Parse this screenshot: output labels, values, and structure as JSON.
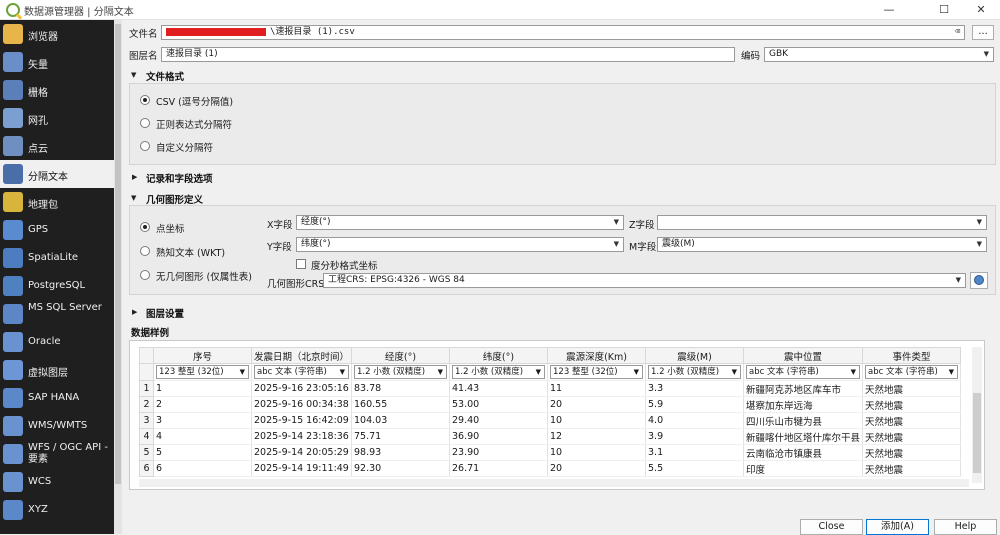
{
  "window": {
    "title": "数据源管理器 | 分隔文本",
    "minimize": "—",
    "maximize": "☐",
    "close": "✕"
  },
  "sidebar": {
    "items": [
      {
        "label": "浏览器",
        "icon": "folder-icon",
        "color": "#e8b54a"
      },
      {
        "label": "矢量",
        "icon": "vector-layer-icon",
        "color": "#6a8fc8"
      },
      {
        "label": "栅格",
        "icon": "raster-layer-icon",
        "color": "#5b7fb8"
      },
      {
        "label": "网孔",
        "icon": "mesh-layer-icon",
        "color": "#7a9fd0"
      },
      {
        "label": "点云",
        "icon": "point-cloud-icon",
        "color": "#6f8fc0"
      },
      {
        "label": "分隔文本",
        "icon": "delimited-text-icon",
        "color": "#4a6fa8"
      },
      {
        "label": "地理包",
        "icon": "geopackage-icon",
        "color": "#d8b43c"
      },
      {
        "label": "GPS",
        "icon": "gps-icon",
        "color": "#5a8ad0"
      },
      {
        "label": "SpatiaLite",
        "icon": "spatialite-icon",
        "color": "#4e7cc0"
      },
      {
        "label": "PostgreSQL",
        "icon": "postgresql-elephant-icon",
        "color": "#4f80c0"
      },
      {
        "label": "MS SQL Server",
        "icon": "mssql-icon",
        "color": "#5c86c6"
      },
      {
        "label": "Oracle",
        "icon": "oracle-database-icon",
        "color": "#6a92d0"
      },
      {
        "label": "虚拟图层",
        "icon": "virtual-layer-icon",
        "color": "#6d96d6"
      },
      {
        "label": "SAP HANA",
        "icon": "sap-hana-icon",
        "color": "#5b88c8"
      },
      {
        "label": "WMS/WMTS",
        "icon": "wms-globe-icon",
        "color": "#6a92cf"
      },
      {
        "label": "WFS / OGC API - 要素",
        "icon": "wfs-globe-icon",
        "color": "#6a92cf"
      },
      {
        "label": "WCS",
        "icon": "wcs-globe-icon",
        "color": "#6a92cf"
      },
      {
        "label": "XYZ",
        "icon": "xyz-tiles-icon",
        "color": "#5b88c8"
      }
    ]
  },
  "file": {
    "label": "文件名",
    "value": "\\速报目录 (1).csv",
    "browse": "…"
  },
  "layer": {
    "label": "图层名",
    "value": "速报目录 (1)",
    "encoding_label": "编码",
    "encoding_value": "GBK"
  },
  "file_format": {
    "title": "文件格式",
    "options": [
      "CSV (逗号分隔值)",
      "正则表达式分隔符",
      "自定义分隔符"
    ],
    "selected": 0
  },
  "records": {
    "title": "记录和字段选项"
  },
  "geometry": {
    "title": "几何图形定义",
    "options": [
      "点坐标",
      "熟知文本 (WKT)",
      "无几何图形 (仅属性表)"
    ],
    "x_label": "X字段",
    "x_value": "经度(°)",
    "y_label": "Y字段",
    "y_value": "纬度(°)",
    "z_label": "Z字段",
    "z_value": "",
    "m_label": "M字段",
    "m_value": "震级(M)",
    "dms_label": "度分秒格式坐标",
    "crs_label": "几何图形CRS",
    "crs_value": "工程CRS: EPSG:4326 - WGS 84"
  },
  "layer_settings": {
    "title": "图层设置"
  },
  "sample": {
    "title": "数据样例",
    "columns": [
      "序号",
      "发震日期（北京时间）",
      "经度(°)",
      "纬度(°)",
      "震源深度(Km)",
      "震级(M)",
      "震中位置",
      "事件类型"
    ],
    "types": [
      "123 整型 (32位)",
      "abc 文本 (字符串)",
      "1.2 小数 (双精度)",
      "1.2 小数 (双精度)",
      "123 整型 (32位)",
      "1.2 小数 (双精度)",
      "abc 文本 (字符串)",
      "abc 文本 (字符串)"
    ],
    "rows": [
      [
        "1",
        "2025-9-16 23:05:16",
        "83.78",
        "41.43",
        "11",
        "3.3",
        "新疆阿克苏地区库车市",
        "天然地震"
      ],
      [
        "2",
        "2025-9-16 00:34:38",
        "160.55",
        "53.00",
        "20",
        "5.9",
        "堪察加东岸远海",
        "天然地震"
      ],
      [
        "3",
        "2025-9-15 16:42:09",
        "104.03",
        "29.40",
        "10",
        "4.0",
        "四川乐山市犍为县",
        "天然地震"
      ],
      [
        "4",
        "2025-9-14 23:18:36",
        "75.71",
        "36.90",
        "12",
        "3.9",
        "新疆喀什地区塔什库尔干县",
        "天然地震"
      ],
      [
        "5",
        "2025-9-14 20:05:29",
        "98.93",
        "23.90",
        "10",
        "3.1",
        "云南临沧市镇康县",
        "天然地震"
      ],
      [
        "6",
        "2025-9-14 19:11:49",
        "92.30",
        "26.71",
        "20",
        "5.5",
        "印度",
        "天然地震"
      ]
    ]
  },
  "buttons": {
    "close": "Close",
    "add": "添加(A)",
    "help": "Help"
  }
}
